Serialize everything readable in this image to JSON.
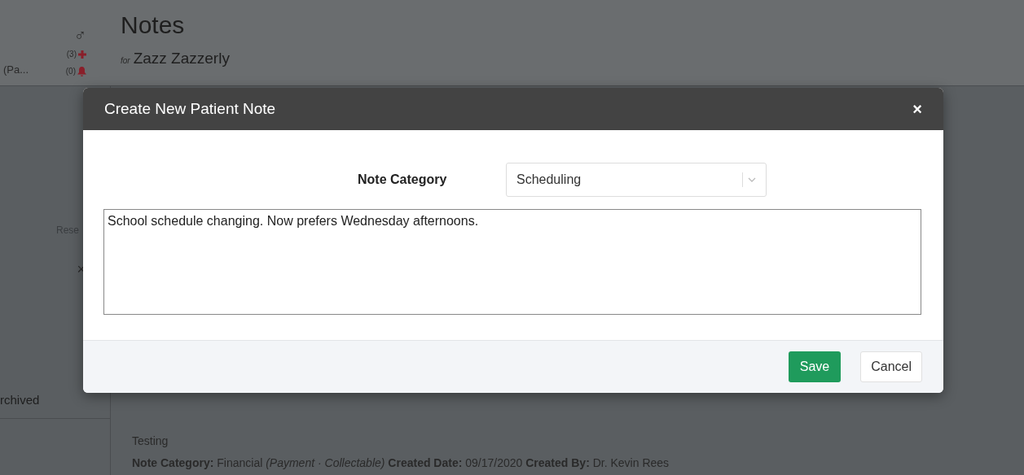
{
  "background": {
    "sidebar": {
      "truncated_name": "(Pa...",
      "gender_symbol": "♂",
      "alerts": [
        {
          "kind": "plus",
          "count": "(3)"
        },
        {
          "kind": "bell",
          "count": "(0)"
        }
      ],
      "reset_label": "Rese",
      "clear_symbol": "×",
      "archived_label": "rchived"
    },
    "header": {
      "title": "Notes",
      "for_label": "for",
      "patient_name": "Zazz Zazzerly"
    },
    "note": {
      "title": "Testing",
      "details": "**Note Category:** Financial *(Payment · Collectable)* **Created Date:** 09/17/2020 **Created By:** Dr. Kevin Rees"
    }
  },
  "dialog": {
    "title": "Create New Patient Note",
    "close_symbol": "×",
    "category_label": "Note Category",
    "category_value": "Scheduling",
    "note_text": "School schedule changing. Now prefers Wednesday afternoons.",
    "buttons": [
      {
        "kind": "primary",
        "label": "Save"
      },
      {
        "kind": "secondary",
        "label": "Cancel"
      }
    ]
  }
}
